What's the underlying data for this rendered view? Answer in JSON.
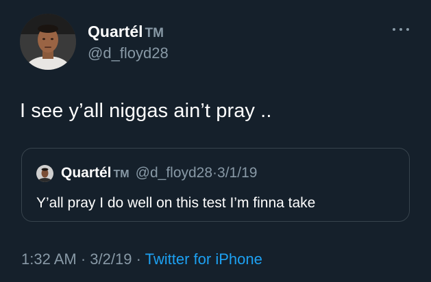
{
  "author": {
    "display_name": "Quartél",
    "badge": "TM",
    "handle": "@d_floyd28"
  },
  "tweet": {
    "text": "I see y’all niggas ain’t pray .."
  },
  "quoted_tweet": {
    "display_name": "Quartél",
    "badge": "TM",
    "handle": "@d_floyd28",
    "separator": "·",
    "date": "3/1/19",
    "text": "Y’all pray I do well on this test I’m finna take"
  },
  "meta": {
    "time": "1:32 AM",
    "separator": "·",
    "date": "3/2/19",
    "source": "Twitter for iPhone"
  },
  "icons": {
    "more": "more-options-icon",
    "avatar": "avatar"
  },
  "colors": {
    "background": "#15202b",
    "text_primary": "#ffffff",
    "text_secondary": "#8899a6",
    "link": "#1da1f2",
    "border": "#38444d"
  }
}
